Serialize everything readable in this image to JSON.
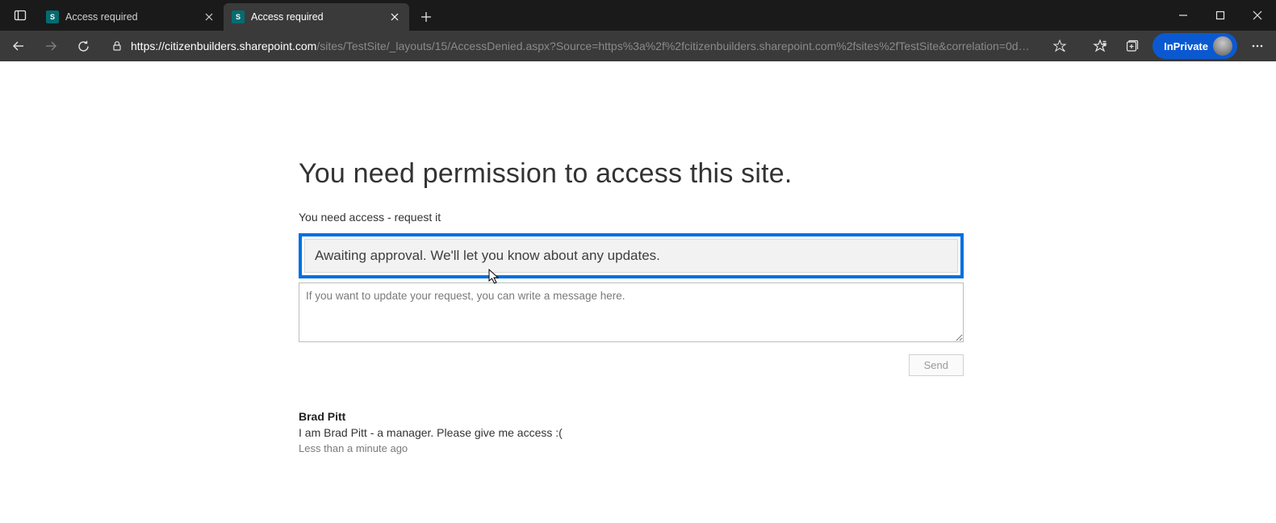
{
  "browser": {
    "tabs": [
      {
        "title": "Access required",
        "icon_text": "S"
      },
      {
        "title": "Access required",
        "icon_text": "S"
      }
    ],
    "inprivate_label": "InPrivate",
    "url_host": "https://citizenbuilders.sharepoint.com",
    "url_rest": "/sites/TestSite/_layouts/15/AccessDenied.aspx?Source=https%3a%2f%2fcitizenbuilders.sharepoint.com%2fsites%2fTestSite&correlation=0d…"
  },
  "content": {
    "title": "You need permission to access this site.",
    "subtitle": "You need access - request it",
    "status_message": "Awaiting approval. We'll let you know about any updates.",
    "message_placeholder": "If you want to update your request, you can write a message here.",
    "send_label": "Send",
    "request": {
      "user": "Brad Pitt",
      "message": "I am Brad Pitt - a manager. Please give me access :(",
      "timestamp": "Less than a minute ago"
    }
  }
}
